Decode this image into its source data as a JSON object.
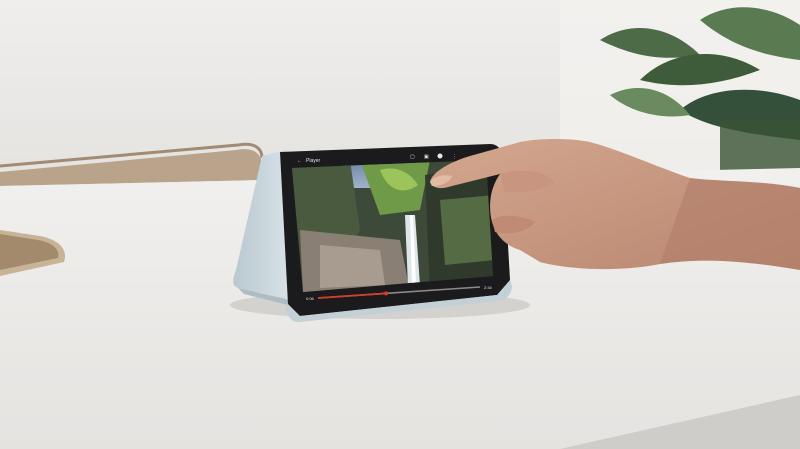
{
  "scene": {
    "description_free": true
  },
  "video_player": {
    "title": "Player",
    "elapsed_time": "0:06",
    "total_time": "2:34",
    "progress_fraction": 0.42,
    "accent_color": "#e0392b"
  },
  "colors": {
    "wall": "#eeedeb",
    "table": "#eceae7",
    "device_shell": "#c9d6dc",
    "screen_bezel": "#1b1b1d",
    "skin": "#c99b84",
    "plant": "#3e5c3a"
  }
}
